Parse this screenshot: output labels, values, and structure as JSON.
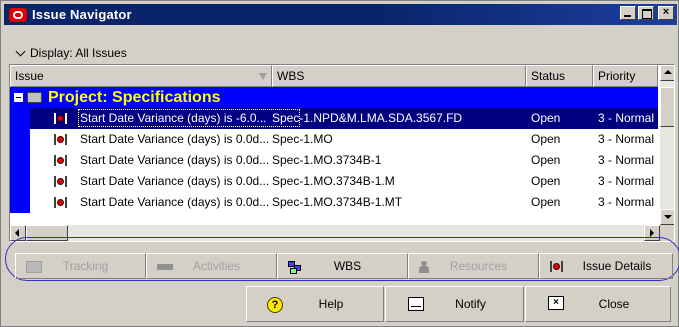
{
  "window": {
    "title": "Issue Navigator",
    "accent_color": "#0a246a",
    "title_buttons": {
      "minimize": "",
      "maximize": "",
      "close": "×"
    }
  },
  "display": {
    "label": "Display: All Issues"
  },
  "grid": {
    "columns": [
      "Issue",
      "WBS",
      "Status",
      "Priority"
    ],
    "project": {
      "label": "Project: Specifications",
      "color": "#ffff00",
      "bg": "#0000ff"
    },
    "rows": [
      {
        "issue": "Start Date Variance (days) is -6.0...",
        "wbs": "Spec-1.NPD&M.LMA.SDA.3567.FD",
        "status": "Open",
        "priority": "3 - Normal",
        "selected": true
      },
      {
        "issue": "Start Date Variance (days) is 0.0d...",
        "wbs": "Spec-1.MO",
        "status": "Open",
        "priority": "3 - Normal",
        "selected": false
      },
      {
        "issue": "Start Date Variance (days) is 0.0d...",
        "wbs": "Spec-1.MO.3734B-1",
        "status": "Open",
        "priority": "3 - Normal",
        "selected": false
      },
      {
        "issue": "Start Date Variance (days) is 0.0d...",
        "wbs": "Spec-1.MO.3734B-1.M",
        "status": "Open",
        "priority": "3 - Normal",
        "selected": false
      },
      {
        "issue": "Start Date Variance (days) is 0.0d...",
        "wbs": "Spec-1.MO.3734B-1.MT",
        "status": "Open",
        "priority": "3 - Normal",
        "selected": false
      }
    ]
  },
  "toolbar": {
    "tracking": "Tracking",
    "activities": "Activities",
    "wbs": "WBS",
    "resources": "Resources",
    "issue_details": "Issue Details"
  },
  "buttons": {
    "help": "Help",
    "help_glyph": "?",
    "notify": "Notify",
    "close": "Close",
    "close_glyph": "×"
  }
}
